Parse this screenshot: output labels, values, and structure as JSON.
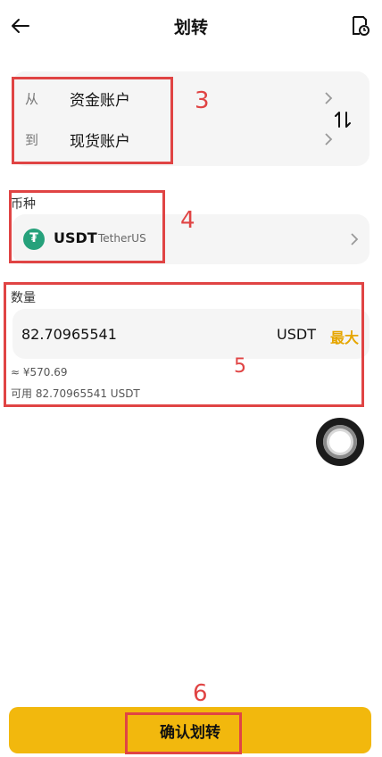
{
  "header": {
    "title": "划转"
  },
  "accounts": {
    "from_label": "从",
    "from_value": "资金账户",
    "to_label": "到",
    "to_value": "现货账户"
  },
  "currency": {
    "section_label": "币种",
    "symbol": "USDT",
    "name": "TetherUS",
    "icon_glyph": "₮"
  },
  "amount": {
    "section_label": "数量",
    "value": "82.70965541",
    "unit": "USDT",
    "max_label": "最大",
    "approx_value": "≈ ¥570.69",
    "available": "可用 82.70965541 USDT"
  },
  "confirm_label": "确认划转",
  "annotations": [
    "3",
    "4",
    "5",
    "6"
  ],
  "colors": {
    "accent": "#f2b80d",
    "max_text": "#e6a600",
    "annotation": "#e04444",
    "card_bg": "#f5f5f5",
    "usdt_green": "#26a17b"
  }
}
